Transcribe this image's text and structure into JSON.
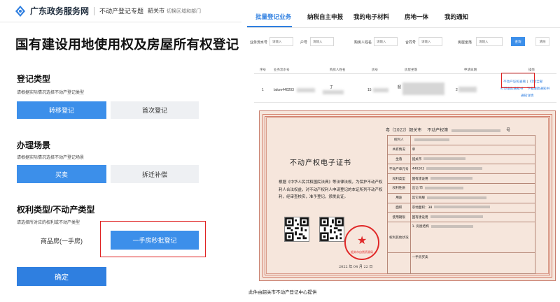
{
  "header": {
    "site_name": "广东政务服务网",
    "topic": "不动产登记专题",
    "city": "韶关市",
    "switch_link": "切换区域和部门"
  },
  "page_title": "国有建设用地使用权及房屋所有权登记",
  "sections": {
    "reg_type": {
      "title": "登记类型",
      "hint": "请根据实际情况选择不动产登记类型",
      "options": [
        "转移登记",
        "首次登记"
      ]
    },
    "scenario": {
      "title": "办理场景",
      "hint": "请根据实际情况选择不动产登记场景",
      "options": [
        "买卖",
        "拆迁补偿"
      ]
    },
    "right_type": {
      "title": "权利类型/不动产类型",
      "hint": "请选择所对应的权利或不动产类型",
      "options": [
        "商品房(一手房)",
        "一手房秒批登记"
      ]
    }
  },
  "confirm_label": "确定",
  "right_nav": {
    "tabs": [
      "批量登记业务",
      "纳税自主申报",
      "我的电子材料",
      "房地一体",
      "我的通知"
    ]
  },
  "filters": {
    "labels": [
      "业务流水号",
      "户号",
      "购房人姓名",
      "合同号",
      "房屋坐落"
    ],
    "placeholder": "请输入",
    "search_label": "查询",
    "clear_label": "清除"
  },
  "table": {
    "headers": [
      "序号",
      "业务流水号",
      "购房人姓名",
      "房号",
      "房屋坐落",
      "申请日期",
      "操作"
    ],
    "row": {
      "index": "1",
      "serial_prefix": "bdcm440203",
      "buyer_prefix": "丁",
      "room_prefix": "15",
      "location_prefix": "韶",
      "date_prefix": "2"
    },
    "actions": [
      "不动产证照查看",
      "打印全部",
      "打印缴款通知书",
      "下载缴款通知书",
      "通知详情"
    ],
    "action_sep": "|"
  },
  "certificate": {
    "year_line": "粤（2022）韶关市",
    "cert_no_label": "不动产权第",
    "no_suffix": "号",
    "title": "不动产权电子证书",
    "body": "根据《中华人民共和国民法典》等法律法规，为保护不动产权利人合法权益，对不动产权利人申请登记的本证所列不动产权利，经审查核实，准予登记，颁发此证。",
    "seal_text": "韶关市自然资源局",
    "date": "2022 年 04 月 22 日",
    "rows": [
      {
        "k": "权利人",
        "v": ""
      },
      {
        "k": "共有情况",
        "v": "单"
      },
      {
        "k": "坐落",
        "v": "韶关市"
      },
      {
        "k": "不动产单元号",
        "v": "440203"
      },
      {
        "k": "权利类型",
        "v": "国有建设用"
      },
      {
        "k": "权利性质",
        "v": "出让/市"
      },
      {
        "k": "用途",
        "v": "其它商服"
      },
      {
        "k": "面积",
        "v": "宗地面积：38"
      },
      {
        "k": "使用期限",
        "v": "国有建设用"
      },
      {
        "k": "权利其他状况",
        "v": "1. 房屋结构"
      },
      {
        "k": "",
        "v": "一手房买卖"
      }
    ]
  },
  "footnote": "此件由韶关市不动产登记中心提供"
}
